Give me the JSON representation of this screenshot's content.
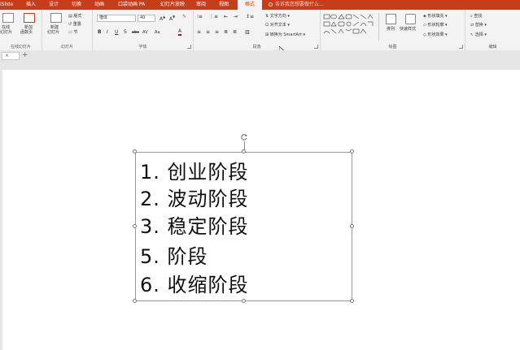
{
  "tabs": [
    "iSlide",
    "插入",
    "设计",
    "切换",
    "动画",
    "口袋动画 PA",
    "幻灯片放映",
    "审阅",
    "视图",
    "格式"
  ],
  "active_tab": "格式",
  "tell_me": "告诉我您想要做什么...",
  "groups": {
    "online": {
      "btn1": "在线",
      "btn1b": "幻灯片",
      "btn2": "新加",
      "btn2b": "函数页",
      "label": "在线幻灯片"
    },
    "slides": {
      "new": "新建",
      "new_b": "幻灯片",
      "layout": "版式",
      "reset": "重置",
      "section": "节",
      "label": "幻灯片"
    },
    "font": {
      "font_name": "楷体",
      "font_size": "40",
      "label": "字体"
    },
    "paragraph": {
      "text_dir": "文字方向",
      "align_text": "对齐文本",
      "smartart": "转换为 SmartArt",
      "label": "段落"
    },
    "drawing": {
      "arrange": "排列",
      "quick_styles": "快速样式",
      "fill": "形状填充",
      "outline": "形状轮廓",
      "effects": "形状效果",
      "label": "绘图"
    },
    "editing": {
      "find": "查找",
      "replace": "替换",
      "select": "选择",
      "label": "编辑"
    }
  },
  "file_tab": "×",
  "new_tab": "+",
  "list_items": [
    "1. 创业阶段",
    "2. 波动阶段",
    "3. 稳定阶段",
    "5. 阶段",
    "6. 收缩阶段"
  ],
  "colors": {
    "accent": "#c43e1c",
    "ribbon": "#f3f3f3",
    "font_red": "#c00000"
  }
}
